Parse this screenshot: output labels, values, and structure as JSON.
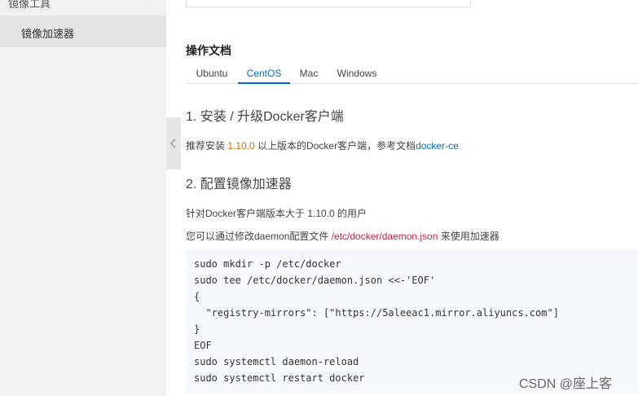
{
  "sidebar": {
    "group_label": "镜像工具",
    "collapse_icon": "close-icon",
    "items": [
      {
        "label": "镜像加速器",
        "active": true
      }
    ]
  },
  "collapse_handle": {
    "icon": "chevron-left-icon"
  },
  "docs": {
    "title": "操作文档",
    "tabs": [
      "Ubuntu",
      "CentOS",
      "Mac",
      "Windows"
    ],
    "active_tab": "CentOS"
  },
  "step1": {
    "heading": "1. 安装 / 升级Docker客户端",
    "text_before": "推荐安装 ",
    "version": "1.10.0",
    "text_after": " 以上版本的Docker客户端，参考文档",
    "link": "docker-ce"
  },
  "step2": {
    "heading": "2. 配置镜像加速器",
    "line1": "针对Docker客户端版本大于 1.10.0 的用户",
    "line2_before": "您可以通过修改daemon配置文件 ",
    "line2_path": "/etc/docker/daemon.json",
    "line2_after": " 来使用加速器",
    "code": [
      "sudo mkdir -p /etc/docker",
      "sudo tee /etc/docker/daemon.json <<-'EOF'",
      "{",
      "  \"registry-mirrors\": [\"https://5aleeac1.mirror.aliyuncs.com\"]",
      "}",
      "EOF",
      "sudo systemctl daemon-reload",
      "sudo systemctl restart docker"
    ]
  },
  "watermark": "CSDN @座上客",
  "colors": {
    "accent": "#0070cc",
    "version": "#e06c00",
    "path": "#c7254e",
    "code_bg": "#f5f8fc"
  }
}
